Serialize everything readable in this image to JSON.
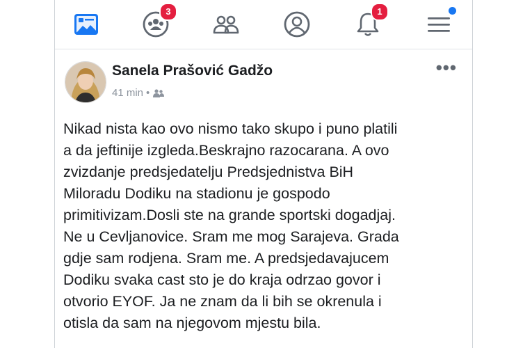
{
  "nav": {
    "friend_requests_badge": "3",
    "notifications_badge": "1"
  },
  "post": {
    "author": "Sanela Prašović Gadžo",
    "time": "41 min",
    "meta_separator": "•",
    "more_label": "•••",
    "lines": [
      "Nikad nista kao ovo nismo tako skupo i puno platili",
      "a da jeftinije izgleda.Beskrajno razocarana. A ovo",
      "zvizdanje predsjedatelju Predsjednistva BiH",
      "Miloradu Dodiku na stadionu je gospodo",
      "primitivizam.Dosli ste na grande sportski dogadjaj.",
      "Ne u Cevljanovice. Sram me mog Sarajeva. Grada",
      "gdje sam rodjena. Sram me. A predsjedavajucem",
      "Dodiku svaka cast sto je do kraja odrzao govor i",
      "otvorio EYOF. Ja ne znam da li bih se okrenula i",
      "otisla da sam na njegovom mjestu bila."
    ]
  },
  "icons": {
    "home": "news-feed-icon",
    "friends": "friend-requests-icon",
    "groups": "groups-icon",
    "profile": "profile-icon",
    "notifications": "bell-icon",
    "menu": "menu-icon",
    "audience": "friends-audience-icon"
  },
  "colors": {
    "accent": "#1877f2",
    "badge": "#e41e3f",
    "icon_gray": "#606770",
    "text": "#1c1e21",
    "meta_text": "#8d949e"
  }
}
